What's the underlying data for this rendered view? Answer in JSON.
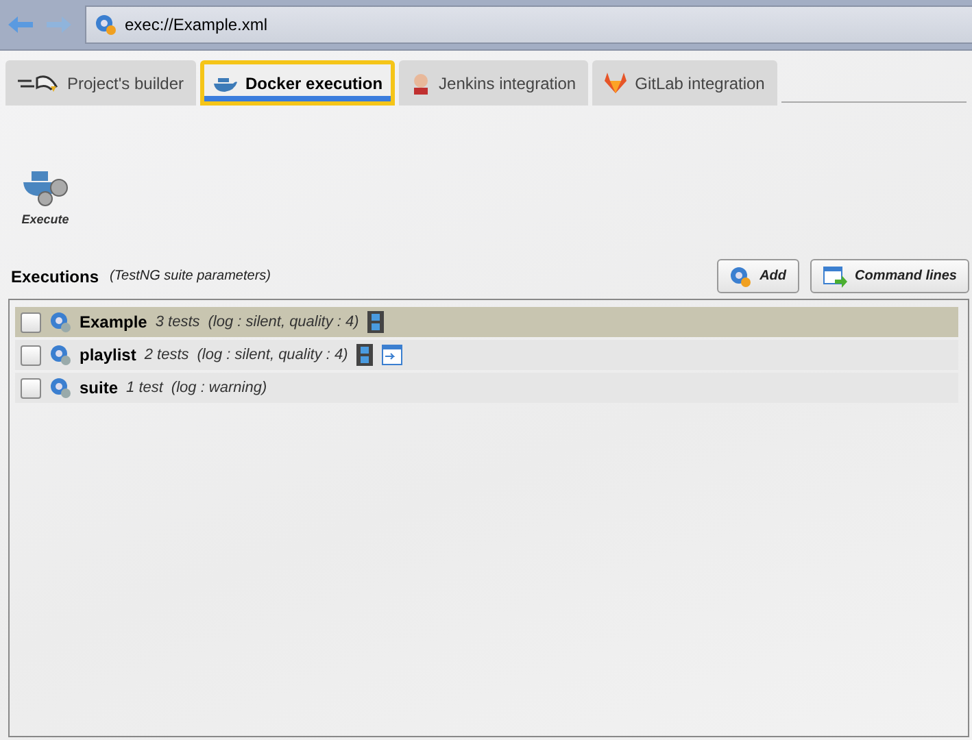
{
  "address_bar": {
    "value": "exec://Example.xml"
  },
  "tabs": [
    {
      "label": "Project's builder",
      "selected": false,
      "kind": "eagle"
    },
    {
      "label": "Docker execution",
      "selected": true,
      "kind": "docker"
    },
    {
      "label": "Jenkins integration",
      "selected": false,
      "kind": "jenkins"
    },
    {
      "label": "GitLab integration",
      "selected": false,
      "kind": "gitlab"
    }
  ],
  "toolbar": {
    "execute_label": "Execute"
  },
  "executions": {
    "title": "Executions",
    "subtitle": "(TestNG suite parameters)",
    "buttons": [
      {
        "label": "Add",
        "kind": "add"
      },
      {
        "label": "Command lines",
        "kind": "commands"
      }
    ],
    "rows": [
      {
        "name": "Example",
        "count": "3 tests",
        "details": "(log : silent, quality : 4)",
        "selected": true,
        "checked": false,
        "video": true,
        "script": false
      },
      {
        "name": "playlist",
        "count": "2 tests",
        "details": "(log : silent, quality : 4)",
        "selected": false,
        "checked": false,
        "video": true,
        "script": true
      },
      {
        "name": "suite",
        "count": "1 test",
        "details": "(log : warning)",
        "selected": false,
        "checked": false,
        "video": false,
        "script": false
      }
    ]
  }
}
